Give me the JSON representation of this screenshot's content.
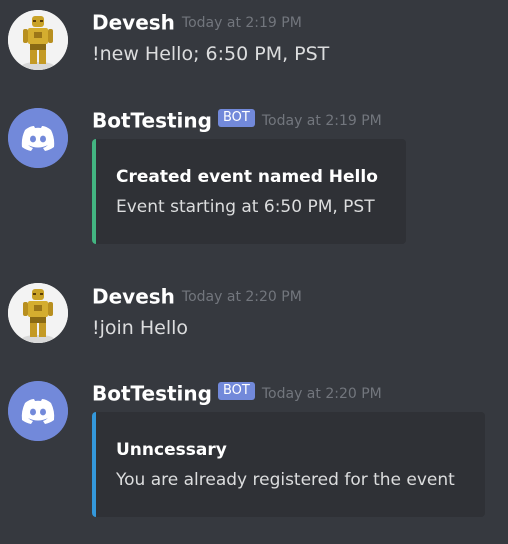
{
  "messages": [
    {
      "author": "Devesh",
      "timestamp": "Today at 2:19 PM",
      "text": "!new Hello; 6:50 PM, PST"
    },
    {
      "author": "BotTesting",
      "tag": "BOT",
      "timestamp": "Today at 2:19 PM",
      "embed": {
        "title": "Created event named Hello",
        "description": "Event starting at 6:50 PM, PST",
        "color": "#43b581"
      }
    },
    {
      "author": "Devesh",
      "timestamp": "Today at 2:20 PM",
      "text": "!join Hello"
    },
    {
      "author": "BotTesting",
      "tag": "BOT",
      "timestamp": "Today at 2:20 PM",
      "embed": {
        "title": "Unncessary",
        "description": "You are already registered for the event",
        "color": "#3498db"
      }
    }
  ],
  "colors": {
    "background": "#36393f",
    "embed_background": "#2f3136",
    "bot_tag": "#7289da",
    "bot_avatar": "#7289da"
  },
  "icons": {
    "user_avatar": "robot-figure-avatar",
    "bot_avatar": "discord-logo-icon"
  }
}
